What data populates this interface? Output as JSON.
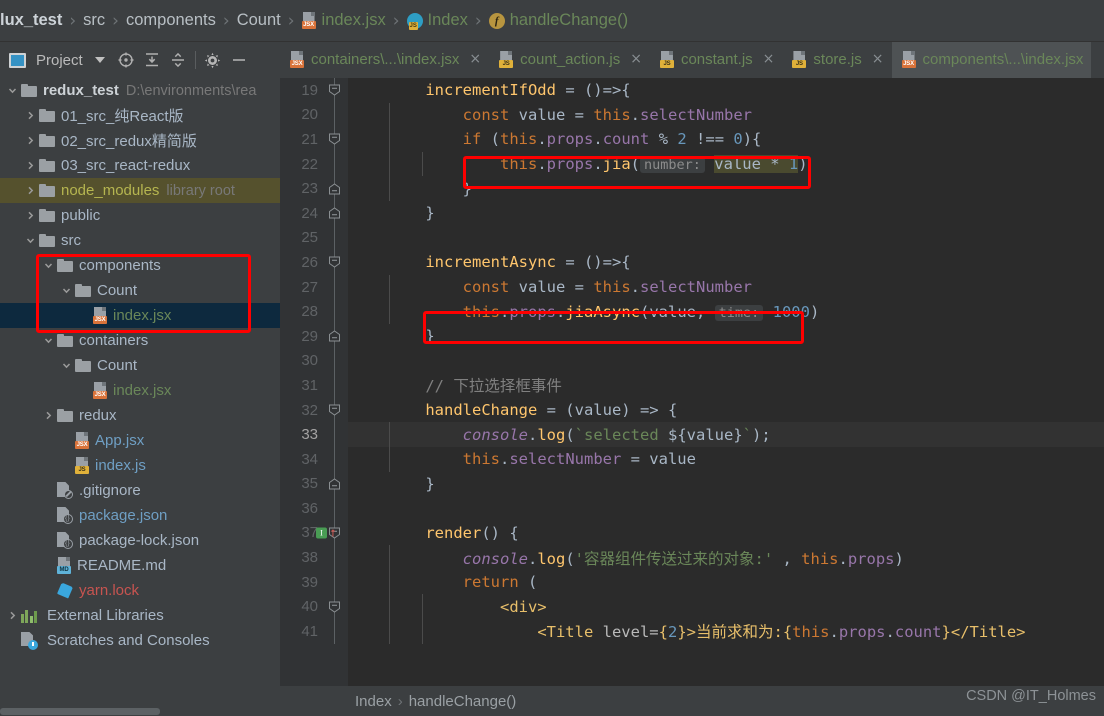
{
  "breadcrumb": {
    "items": [
      {
        "label": "lux_test",
        "style": "bold",
        "icon": ""
      },
      {
        "label": "src",
        "style": "plain",
        "icon": ""
      },
      {
        "label": "components",
        "style": "plain",
        "icon": ""
      },
      {
        "label": "Count",
        "style": "plain",
        "icon": ""
      },
      {
        "label": "index.jsx",
        "style": "green",
        "icon": "jsx-file-icon"
      },
      {
        "label": "Index",
        "style": "green",
        "icon": "js-class-icon"
      },
      {
        "label": "handleChange()",
        "style": "green",
        "icon": "function-icon"
      }
    ]
  },
  "project_toolbar": {
    "title": "Project",
    "icons": [
      "window-icon",
      "chevron-down-icon",
      "locate-icon",
      "expand-all-icon",
      "collapse-all-icon",
      "gear-icon",
      "hide-icon"
    ]
  },
  "editor_tabs": [
    {
      "label": "containers\\...\\index.jsx",
      "icon": "jsx-file-icon",
      "active": false,
      "closable": true
    },
    {
      "label": "count_action.js",
      "icon": "js-file-icon",
      "active": false,
      "closable": true
    },
    {
      "label": "constant.js",
      "icon": "js-file-icon",
      "active": false,
      "closable": true
    },
    {
      "label": "store.js",
      "icon": "js-file-icon",
      "active": false,
      "closable": true
    },
    {
      "label": "components\\...\\index.jsx",
      "icon": "jsx-file-icon",
      "active": true,
      "closable": false
    }
  ],
  "project_tree": [
    {
      "indent": 0,
      "arrow": "down",
      "icon": "folder",
      "label": "redux_test",
      "style": "bold",
      "note": "D:\\environments\\rea",
      "selected": ""
    },
    {
      "indent": 1,
      "arrow": "right",
      "icon": "folder",
      "label": "01_src_纯React版",
      "style": "plain",
      "note": "",
      "selected": ""
    },
    {
      "indent": 1,
      "arrow": "right",
      "icon": "folder",
      "label": "02_src_redux精简版",
      "style": "plain",
      "note": "",
      "selected": ""
    },
    {
      "indent": 1,
      "arrow": "right",
      "icon": "folder",
      "label": "03_src_react-redux",
      "style": "plain",
      "note": "",
      "selected": ""
    },
    {
      "indent": 1,
      "arrow": "right",
      "icon": "folder",
      "label": "node_modules",
      "style": "olive",
      "note": "library root",
      "selected": "olive"
    },
    {
      "indent": 1,
      "arrow": "right",
      "icon": "folder",
      "label": "public",
      "style": "plain",
      "note": "",
      "selected": ""
    },
    {
      "indent": 1,
      "arrow": "down",
      "icon": "folder",
      "label": "src",
      "style": "plain",
      "note": "",
      "selected": ""
    },
    {
      "indent": 2,
      "arrow": "down",
      "icon": "folder",
      "label": "components",
      "style": "plain",
      "note": "",
      "selected": ""
    },
    {
      "indent": 3,
      "arrow": "down",
      "icon": "folder",
      "label": "Count",
      "style": "plain",
      "note": "",
      "selected": ""
    },
    {
      "indent": 4,
      "arrow": "none",
      "icon": "jsx",
      "label": "index.jsx",
      "style": "green",
      "note": "",
      "selected": "blue"
    },
    {
      "indent": 2,
      "arrow": "down",
      "icon": "folder",
      "label": "containers",
      "style": "plain",
      "note": "",
      "selected": ""
    },
    {
      "indent": 3,
      "arrow": "down",
      "icon": "folder",
      "label": "Count",
      "style": "plain",
      "note": "",
      "selected": ""
    },
    {
      "indent": 4,
      "arrow": "none",
      "icon": "jsx",
      "label": "index.jsx",
      "style": "green",
      "note": "",
      "selected": ""
    },
    {
      "indent": 2,
      "arrow": "right",
      "icon": "folder",
      "label": "redux",
      "style": "plain",
      "note": "",
      "selected": ""
    },
    {
      "indent": 3,
      "arrow": "none",
      "icon": "jsx",
      "label": "App.jsx",
      "style": "blue",
      "note": "",
      "selected": ""
    },
    {
      "indent": 3,
      "arrow": "none",
      "icon": "js",
      "label": "index.js",
      "style": "blue",
      "note": "",
      "selected": ""
    },
    {
      "indent": 2,
      "arrow": "none",
      "icon": "gitignore",
      "label": ".gitignore",
      "style": "plain",
      "note": "",
      "selected": ""
    },
    {
      "indent": 2,
      "arrow": "none",
      "icon": "json",
      "label": "package.json",
      "style": "blue",
      "note": "",
      "selected": ""
    },
    {
      "indent": 2,
      "arrow": "none",
      "icon": "json",
      "label": "package-lock.json",
      "style": "plain",
      "note": "",
      "selected": ""
    },
    {
      "indent": 2,
      "arrow": "none",
      "icon": "md",
      "label": "README.md",
      "style": "plain",
      "note": "",
      "selected": ""
    },
    {
      "indent": 2,
      "arrow": "none",
      "icon": "yarn",
      "label": "yarn.lock",
      "style": "red",
      "note": "",
      "selected": ""
    },
    {
      "indent": 0,
      "arrow": "right",
      "icon": "libs",
      "label": "External Libraries",
      "style": "plain",
      "note": "",
      "selected": ""
    },
    {
      "indent": 0,
      "arrow": "none",
      "icon": "scratch",
      "label": "Scratches and Consoles",
      "style": "plain",
      "note": "",
      "selected": ""
    }
  ],
  "code": {
    "first_line_number": 19,
    "lines": [
      {
        "n": 19,
        "fold": "down",
        "indent_guides": 0,
        "current": false,
        "tokens": [
          {
            "t": "    ",
            "c": "plain"
          },
          {
            "t": "incrementIfOdd",
            "c": "fn"
          },
          {
            "t": " = ()=>{",
            "c": "plain"
          }
        ]
      },
      {
        "n": 20,
        "fold": "none",
        "indent_guides": 1,
        "current": false,
        "tokens": [
          {
            "t": "        ",
            "c": "plain"
          },
          {
            "t": "const",
            "c": "kw"
          },
          {
            "t": " value = ",
            "c": "plain"
          },
          {
            "t": "this",
            "c": "kw"
          },
          {
            "t": ".",
            "c": "plain"
          },
          {
            "t": "selectNumber",
            "c": "var"
          }
        ]
      },
      {
        "n": 21,
        "fold": "down",
        "indent_guides": 1,
        "current": false,
        "tokens": [
          {
            "t": "        ",
            "c": "plain"
          },
          {
            "t": "if",
            "c": "kw"
          },
          {
            "t": " (",
            "c": "plain"
          },
          {
            "t": "this",
            "c": "kw"
          },
          {
            "t": ".",
            "c": "plain"
          },
          {
            "t": "props",
            "c": "var"
          },
          {
            "t": ".",
            "c": "plain"
          },
          {
            "t": "count",
            "c": "var"
          },
          {
            "t": " % ",
            "c": "plain"
          },
          {
            "t": "2",
            "c": "num"
          },
          {
            "t": " !== ",
            "c": "plain"
          },
          {
            "t": "0",
            "c": "num"
          },
          {
            "t": "){",
            "c": "plain"
          }
        ]
      },
      {
        "n": 22,
        "fold": "none",
        "indent_guides": 2,
        "current": false,
        "boxed": true,
        "tokens": [
          {
            "t": "            ",
            "c": "plain"
          },
          {
            "t": "this",
            "c": "kw"
          },
          {
            "t": ".",
            "c": "plain"
          },
          {
            "t": "props",
            "c": "var"
          },
          {
            "t": ".",
            "c": "plain"
          },
          {
            "t": "jia",
            "c": "fn"
          },
          {
            "t": "(",
            "c": "plain"
          },
          {
            "t": "number:",
            "c": "hint"
          },
          {
            "t": " ",
            "c": "plain"
          },
          {
            "t": "value * ",
            "c": "hlplain"
          },
          {
            "t": "1",
            "c": "hlnum"
          },
          {
            "t": ")",
            "c": "plain"
          }
        ]
      },
      {
        "n": 23,
        "fold": "up",
        "indent_guides": 1,
        "current": false,
        "tokens": [
          {
            "t": "        }",
            "c": "plain"
          }
        ]
      },
      {
        "n": 24,
        "fold": "up",
        "indent_guides": 0,
        "current": false,
        "tokens": [
          {
            "t": "    }",
            "c": "plain"
          }
        ]
      },
      {
        "n": 25,
        "fold": "none",
        "indent_guides": 0,
        "current": false,
        "tokens": []
      },
      {
        "n": 26,
        "fold": "down",
        "indent_guides": 0,
        "current": false,
        "tokens": [
          {
            "t": "    ",
            "c": "plain"
          },
          {
            "t": "incrementAsync",
            "c": "fn"
          },
          {
            "t": " = ()=>{",
            "c": "plain"
          }
        ]
      },
      {
        "n": 27,
        "fold": "none",
        "indent_guides": 1,
        "current": false,
        "tokens": [
          {
            "t": "        ",
            "c": "plain"
          },
          {
            "t": "const",
            "c": "kw"
          },
          {
            "t": " value = ",
            "c": "plain"
          },
          {
            "t": "this",
            "c": "kw"
          },
          {
            "t": ".",
            "c": "plain"
          },
          {
            "t": "selectNumber",
            "c": "var"
          }
        ]
      },
      {
        "n": 28,
        "fold": "none",
        "indent_guides": 1,
        "current": false,
        "boxed": true,
        "tokens": [
          {
            "t": "        ",
            "c": "plain"
          },
          {
            "t": "this",
            "c": "kw"
          },
          {
            "t": ".",
            "c": "plain"
          },
          {
            "t": "props",
            "c": "var"
          },
          {
            "t": ".",
            "c": "plain"
          },
          {
            "t": "jiaAsync",
            "c": "fn"
          },
          {
            "t": "(value, ",
            "c": "plain"
          },
          {
            "t": "time:",
            "c": "hint"
          },
          {
            "t": " ",
            "c": "plain"
          },
          {
            "t": "1000",
            "c": "num"
          },
          {
            "t": ")",
            "c": "plain"
          }
        ]
      },
      {
        "n": 29,
        "fold": "up",
        "indent_guides": 0,
        "current": false,
        "tokens": [
          {
            "t": "    }",
            "c": "plain"
          }
        ]
      },
      {
        "n": 30,
        "fold": "none",
        "indent_guides": 0,
        "current": false,
        "tokens": []
      },
      {
        "n": 31,
        "fold": "none",
        "indent_guides": 0,
        "current": false,
        "tokens": [
          {
            "t": "    // 下拉选择框事件",
            "c": "cmt"
          }
        ]
      },
      {
        "n": 32,
        "fold": "down",
        "indent_guides": 0,
        "current": false,
        "tokens": [
          {
            "t": "    ",
            "c": "plain"
          },
          {
            "t": "handleChange",
            "c": "fn"
          },
          {
            "t": " = (value) => {",
            "c": "plain"
          }
        ]
      },
      {
        "n": 33,
        "fold": "none",
        "indent_guides": 1,
        "current": true,
        "tokens": [
          {
            "t": "        ",
            "c": "plain"
          },
          {
            "t": "console",
            "c": "staticfn"
          },
          {
            "t": ".",
            "c": "plain"
          },
          {
            "t": "log",
            "c": "fn"
          },
          {
            "t": "(",
            "c": "plain"
          },
          {
            "t": "`selected ",
            "c": "str"
          },
          {
            "t": "${value}",
            "c": "plain"
          },
          {
            "t": "`",
            "c": "str"
          },
          {
            "t": ");",
            "c": "plain"
          }
        ]
      },
      {
        "n": 34,
        "fold": "none",
        "indent_guides": 1,
        "current": false,
        "tokens": [
          {
            "t": "        ",
            "c": "plain"
          },
          {
            "t": "this",
            "c": "kw"
          },
          {
            "t": ".",
            "c": "plain"
          },
          {
            "t": "selectNumber",
            "c": "var"
          },
          {
            "t": " = value",
            "c": "plain"
          }
        ]
      },
      {
        "n": 35,
        "fold": "up",
        "indent_guides": 0,
        "current": false,
        "tokens": [
          {
            "t": "    }",
            "c": "plain"
          }
        ]
      },
      {
        "n": 36,
        "fold": "none",
        "indent_guides": 0,
        "current": false,
        "tokens": []
      },
      {
        "n": 37,
        "fold": "down",
        "indent_guides": 0,
        "current": false,
        "override": true,
        "tokens": [
          {
            "t": "    ",
            "c": "plain"
          },
          {
            "t": "render",
            "c": "fn"
          },
          {
            "t": "() {",
            "c": "plain"
          }
        ]
      },
      {
        "n": 38,
        "fold": "none",
        "indent_guides": 1,
        "current": false,
        "tokens": [
          {
            "t": "        ",
            "c": "plain"
          },
          {
            "t": "console",
            "c": "staticfn"
          },
          {
            "t": ".",
            "c": "plain"
          },
          {
            "t": "log",
            "c": "fn"
          },
          {
            "t": "(",
            "c": "plain"
          },
          {
            "t": "'容器组件传送过来的对象:'",
            "c": "str"
          },
          {
            "t": " , ",
            "c": "plain"
          },
          {
            "t": "this",
            "c": "kw"
          },
          {
            "t": ".",
            "c": "plain"
          },
          {
            "t": "props",
            "c": "var"
          },
          {
            "t": ")",
            "c": "plain"
          }
        ]
      },
      {
        "n": 39,
        "fold": "none",
        "indent_guides": 1,
        "current": false,
        "tokens": [
          {
            "t": "        ",
            "c": "plain"
          },
          {
            "t": "return",
            "c": "kw"
          },
          {
            "t": " (",
            "c": "plain"
          }
        ]
      },
      {
        "n": 40,
        "fold": "down",
        "indent_guides": 2,
        "current": false,
        "tokens": [
          {
            "t": "            ",
            "c": "plain"
          },
          {
            "t": "<div>",
            "c": "tag"
          }
        ]
      },
      {
        "n": 41,
        "fold": "none",
        "indent_guides": 2,
        "current": false,
        "tokens": [
          {
            "t": "                ",
            "c": "plain"
          },
          {
            "t": "<Title ",
            "c": "tag"
          },
          {
            "t": "level=",
            "c": "attr"
          },
          {
            "t": "{",
            "c": "tag"
          },
          {
            "t": "2",
            "c": "num"
          },
          {
            "t": "}",
            "c": "tag"
          },
          {
            "t": ">当前求和为:{",
            "c": "tag"
          },
          {
            "t": "this",
            "c": "kw"
          },
          {
            "t": ".",
            "c": "plain"
          },
          {
            "t": "props",
            "c": "var"
          },
          {
            "t": ".",
            "c": "plain"
          },
          {
            "t": "count",
            "c": "var"
          },
          {
            "t": "}</Title>",
            "c": "tag"
          }
        ]
      }
    ]
  },
  "navigation_bar": {
    "items": [
      "Index",
      "handleChange()"
    ],
    "separator": "›"
  },
  "watermark": "CSDN @IT_Holmes",
  "colors": {
    "accent_red_annotation": "#ff0000",
    "editor_bg": "#2b2b2b",
    "gutter_bg": "#313335",
    "panel_bg": "#3c3f41",
    "tree_selection_blue": "#0d293e",
    "tree_selection_olive": "#55512d",
    "tab_active_bg": "#4e5254",
    "string_green": "#6a8759",
    "keyword_orange": "#cc7832",
    "function_yellow": "#ffc66d",
    "field_purple": "#9876aa",
    "number_blue": "#6897bb"
  }
}
